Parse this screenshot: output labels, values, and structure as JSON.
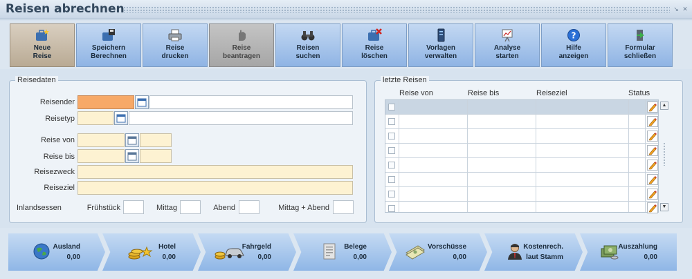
{
  "window": {
    "title": "Reisen abrechnen"
  },
  "toolbar": [
    {
      "line1": "Neue",
      "line2": "Reise",
      "icon": "new-trip-icon"
    },
    {
      "line1": "Speichern",
      "line2": "Berechnen",
      "icon": "save-icon"
    },
    {
      "line1": "Reise",
      "line2": "drucken",
      "icon": "printer-icon"
    },
    {
      "line1": "Reise",
      "line2": "beantragen",
      "icon": "hand-icon"
    },
    {
      "line1": "Reisen",
      "line2": "suchen",
      "icon": "binoculars-icon"
    },
    {
      "line1": "Reise",
      "line2": "löschen",
      "icon": "delete-trip-icon"
    },
    {
      "line1": "Vorlagen",
      "line2": "verwalten",
      "icon": "server-icon"
    },
    {
      "line1": "Analyse",
      "line2": "starten",
      "icon": "chart-board-icon"
    },
    {
      "line1": "Hilfe",
      "line2": "anzeigen",
      "icon": "help-icon"
    },
    {
      "line1": "Formular",
      "line2": "schließen",
      "icon": "exit-door-icon"
    }
  ],
  "reisedaten": {
    "legend": "Reisedaten",
    "reisender": "Reisender",
    "reisetyp": "Reisetyp",
    "reise_von": "Reise von",
    "reise_bis": "Reise bis",
    "reisezweck": "Reisezweck",
    "reiseziel": "Reiseziel",
    "inlandsessen": "Inlandsessen",
    "fruehstueck": "Frühstück",
    "mittag": "Mittag",
    "abend": "Abend",
    "mittag_abend": "Mittag + Abend"
  },
  "letzte_reisen": {
    "legend": "letzte Reisen",
    "columns": [
      "Reise von",
      "Reise bis",
      "Reiseziel",
      "Status"
    ],
    "rows": 8
  },
  "navbar": [
    {
      "label": "Ausland",
      "value": "0,00",
      "icon": "globe-icon"
    },
    {
      "label": "Hotel",
      "value": "0,00",
      "icon": "coins-stars-icon"
    },
    {
      "label": "Fahrgeld",
      "value": "0,00",
      "icon": "car-coins-icon"
    },
    {
      "label": "Belege",
      "value": "0,00",
      "icon": "receipt-icon"
    },
    {
      "label": "Vorschüsse",
      "value": "0,00",
      "icon": "banknotes-icon"
    },
    {
      "label": "Kostenrech.",
      "value": "laut Stamm",
      "icon": "person-icon"
    },
    {
      "label": "Auszahlung",
      "value": "0,00",
      "icon": "cash-icon"
    }
  ],
  "colors": {
    "toolbar_button": "#9dbde8",
    "active_button": "#c8bba7",
    "required_field": "#f7a968",
    "field_yellow": "#fdf2d2"
  }
}
